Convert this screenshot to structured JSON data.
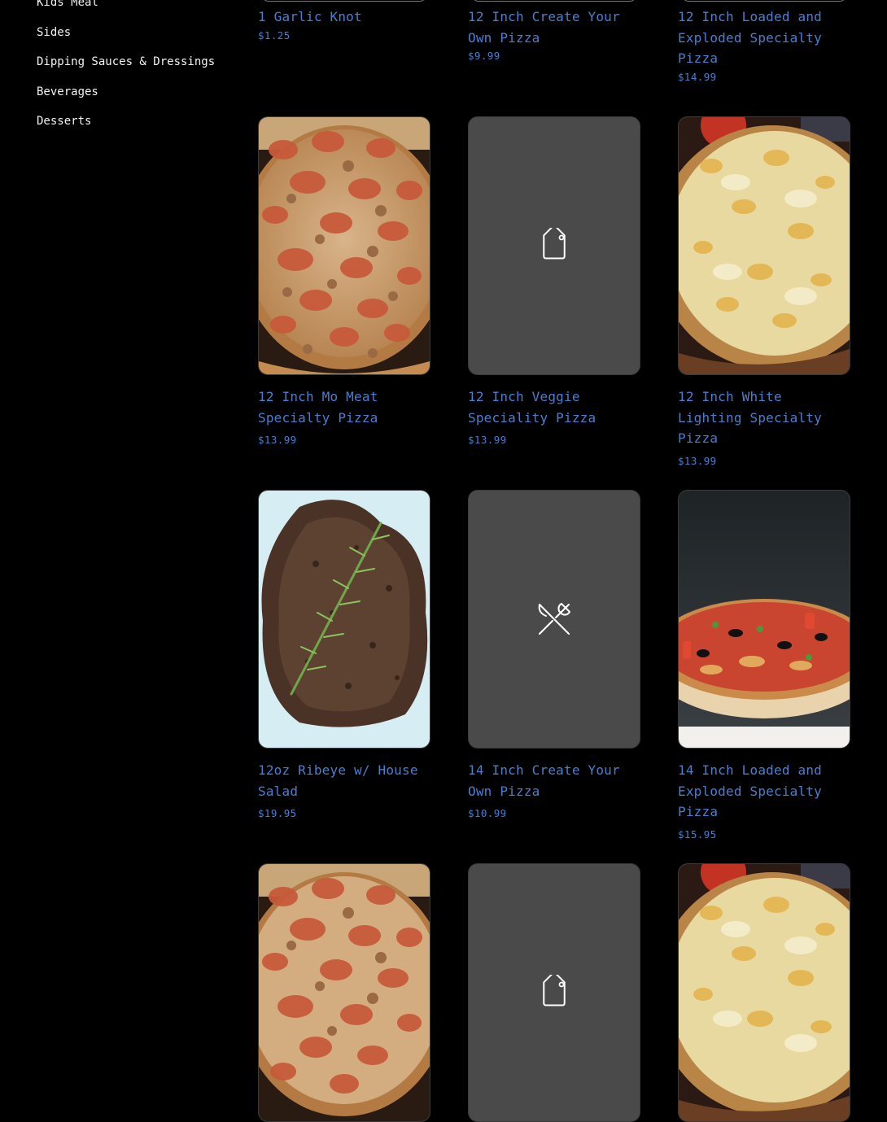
{
  "sidebar": {
    "items": [
      {
        "label": "Kids Meal"
      },
      {
        "label": "Sides"
      },
      {
        "label": "Dipping Sauces & Dressings"
      },
      {
        "label": "Beverages"
      },
      {
        "label": "Desserts"
      }
    ]
  },
  "products": [
    {
      "name": "1 Garlic Knot",
      "price": "$1.25"
    },
    {
      "name": "12 Inch Create Your Own Pizza",
      "price": "$9.99"
    },
    {
      "name": "12 Inch Loaded and Exploded Specialty Pizza",
      "price": "$14.99"
    },
    {
      "name": "12 Inch Mo Meat Specialty Pizza",
      "price": "$13.99",
      "image": "pepperoni-sausage-pizza"
    },
    {
      "name": "12 Inch Veggie Speciality Pizza",
      "price": "$13.99",
      "image": "tag-icon"
    },
    {
      "name": "12 Inch White Lighting Specialty Pizza",
      "price": "$13.99",
      "image": "white-cheese-pizza"
    },
    {
      "name": "12oz Ribeye w/ House Salad",
      "price": "$19.95",
      "image": "ribeye-steak-rosemary"
    },
    {
      "name": "14 Inch Create Your Own Pizza",
      "price": "$10.99",
      "image": "utensils-icon"
    },
    {
      "name": "14 Inch Loaded and Exploded Specialty Pizza",
      "price": "$15.95",
      "image": "loaded-pizza"
    },
    {
      "image": "pepperoni-sausage-pizza"
    },
    {
      "image": "tag-icon"
    },
    {
      "image": "white-cheese-pizza"
    }
  ],
  "colors": {
    "background": "#000000",
    "link": "#4a7fd0",
    "sidebar_text": "#f2f2f2",
    "placeholder": "#4a4a4a"
  }
}
